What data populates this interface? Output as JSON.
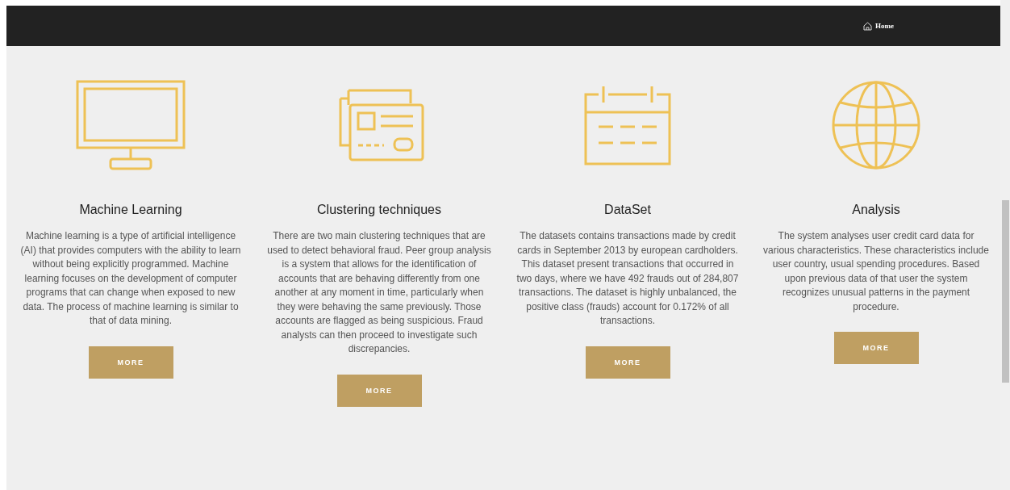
{
  "nav": {
    "home_link": "Home"
  },
  "features": [
    {
      "kind": "monitor",
      "title": "Machine Learning",
      "text": "Machine learning is a type of artificial intelligence (AI) that provides computers with the ability to learn without being explicitly programmed. Machine learning focuses on the development of computer programs that can change when exposed to new data. The process of machine learning is similar to that of data mining.",
      "button": "MORE"
    },
    {
      "kind": "cards",
      "title": "Clustering techniques",
      "text": "There are two main clustering techniques that are used to detect behavioral fraud. Peer group analysis is a system that allows for the identification of accounts that are behaving differently from one another at any moment in time, particularly when they were behaving the same previously. Those accounts are flagged as being suspicious. Fraud analysts can then proceed to investigate such discrepancies.",
      "button": "MORE"
    },
    {
      "kind": "calendar",
      "title": "DataSet",
      "text": "The datasets contains transactions made by credit cards in September 2013 by european cardholders. This dataset present transactions that occurred in two days, where we have 492 frauds out of 284,807 transactions. The dataset is highly unbalanced, the positive class (frauds) account for 0.172% of all transactions.",
      "button": "MORE"
    },
    {
      "kind": "globe",
      "title": "Analysis",
      "text": "The system analyses user credit card data for various characteristics. These characteristics include user country, usual spending procedures. Based upon previous data of that user the system recognizes unusual patterns in the payment procedure.",
      "button": "MORE"
    }
  ]
}
